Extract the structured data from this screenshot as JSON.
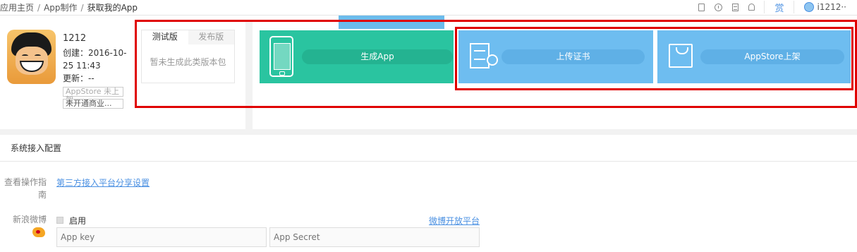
{
  "breadcrumb": {
    "items": [
      "应用主页",
      "App制作",
      "获取我的App"
    ],
    "separator": "/"
  },
  "topbar": {
    "icons": [
      "document-icon",
      "clock-icon",
      "list-icon",
      "bell-icon"
    ],
    "prize_label": "赏",
    "username": "i1212··"
  },
  "app": {
    "name": "1212",
    "created_label": "创建：2016-10-25 11:43",
    "updated_label": "更新：--",
    "store_badge": "AppStore 未上架",
    "biz_badge": "未开通商业..."
  },
  "versions": {
    "tabs": [
      "测试版",
      "发布版"
    ],
    "active_tab": 0,
    "empty_text": "暂未生成此类版本包"
  },
  "actions": {
    "generate": "生成App",
    "upload_cert": "上传证书",
    "appstore": "AppStore上架"
  },
  "colors": {
    "generate_card": "#2ac4a0",
    "upload_card": "#6ebdf0",
    "annotation": "#e00000",
    "link": "#4a90e2"
  },
  "config": {
    "title": "系统接入配置",
    "guide_label": "查看操作指南",
    "guide_link": "第三方接入平台分享设置",
    "weibo_label": "新浪微博",
    "enable_label": "启用",
    "weibo_platform_link": "微博开放平台",
    "app_key_placeholder": "App key",
    "app_secret_placeholder": "App Secret"
  }
}
